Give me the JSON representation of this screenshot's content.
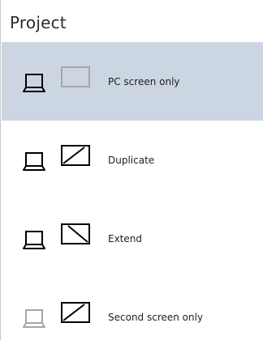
{
  "panel": {
    "title": "Project"
  },
  "options": [
    {
      "id": "pc-screen-only",
      "label": "PC screen only",
      "selected": true,
      "icon": "pc-screen-only-icon"
    },
    {
      "id": "duplicate",
      "label": "Duplicate",
      "selected": false,
      "icon": "duplicate-icon"
    },
    {
      "id": "extend",
      "label": "Extend",
      "selected": false,
      "icon": "extend-icon"
    },
    {
      "id": "second-screen-only",
      "label": "Second screen only",
      "selected": false,
      "icon": "second-screen-only-icon"
    }
  ],
  "colors": {
    "selected_background": "#ccd6e3",
    "icon_active": "#000000",
    "icon_inactive": "#a6a6a6"
  }
}
